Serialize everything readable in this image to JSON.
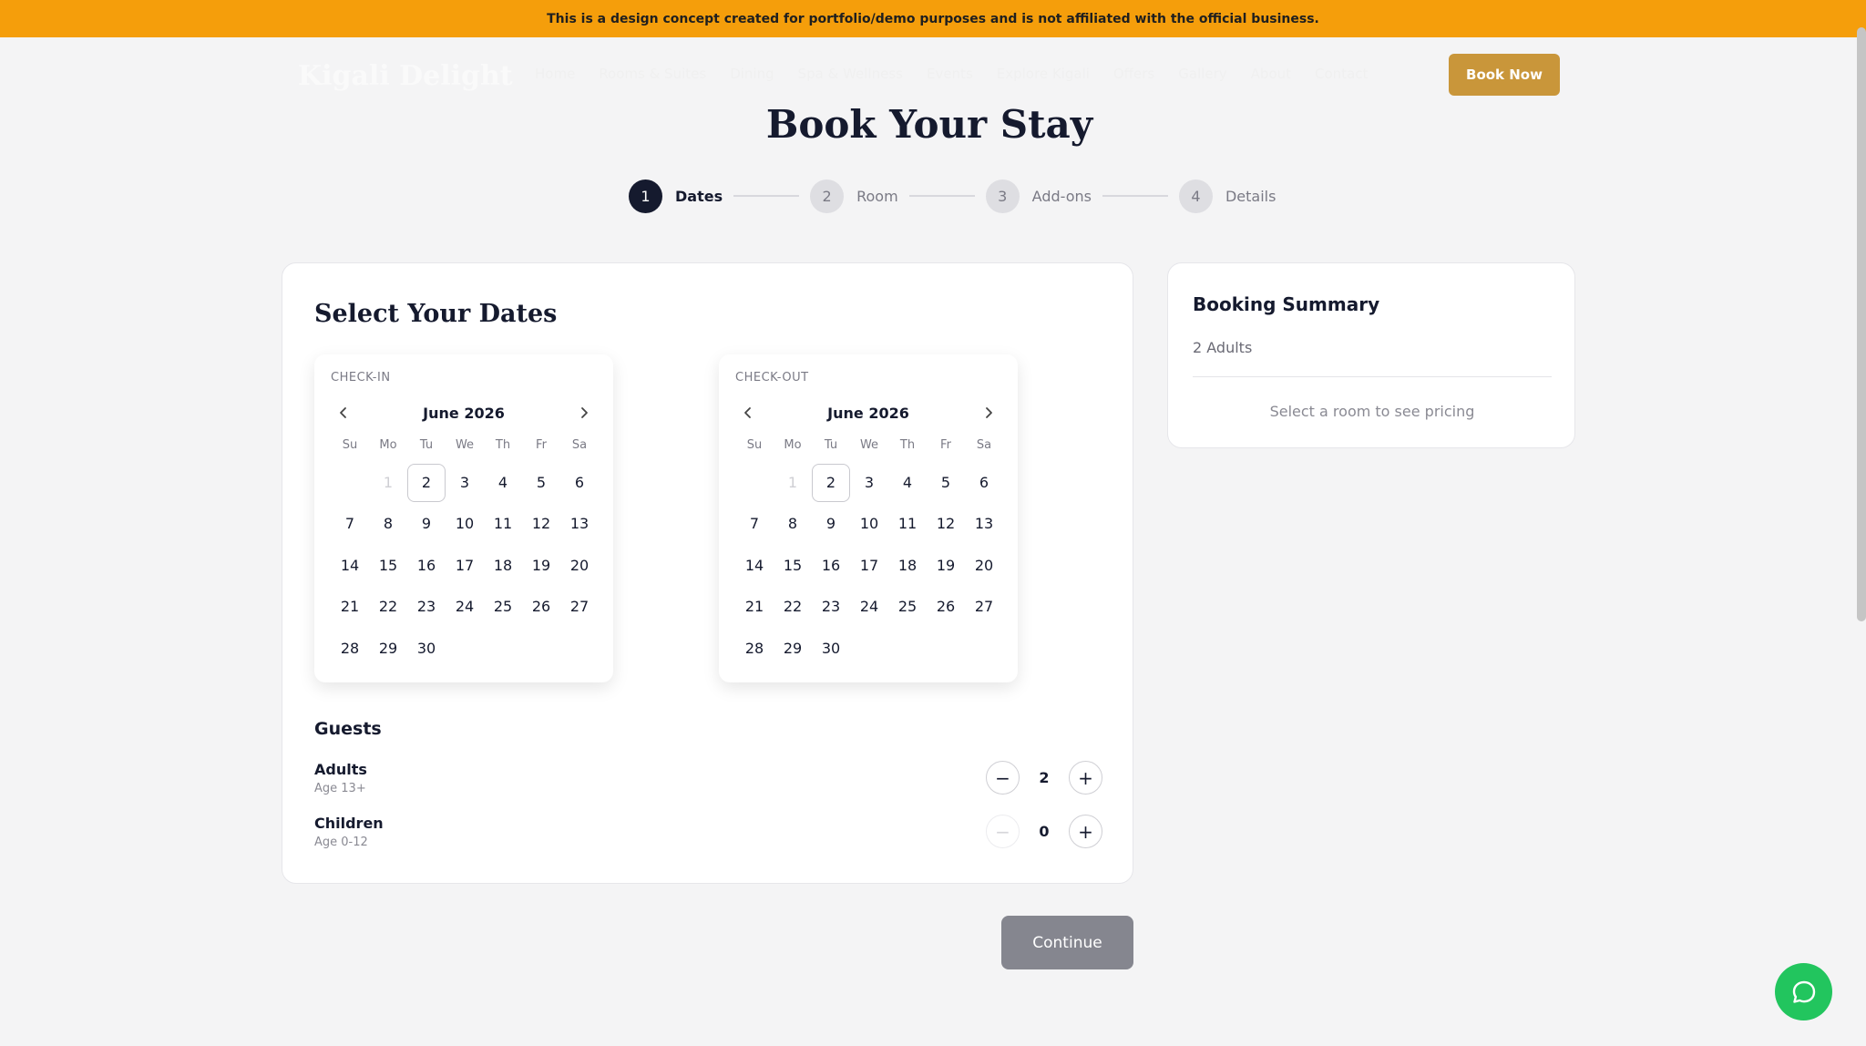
{
  "banner": {
    "text": "This is a design concept created for portfolio/demo purposes and is not affiliated with the official business."
  },
  "nav": {
    "logo": "Kigali Delight",
    "links": [
      "Home",
      "Rooms & Suites",
      "Dining",
      "Spa & Wellness",
      "Events",
      "Explore Kigali",
      "Offers",
      "Gallery",
      "About",
      "Contact"
    ],
    "book_now": "Book Now"
  },
  "page": {
    "title": "Book Your Stay"
  },
  "steps": [
    {
      "num": "1",
      "label": "Dates",
      "active": true
    },
    {
      "num": "2",
      "label": "Room",
      "active": false
    },
    {
      "num": "3",
      "label": "Add-ons",
      "active": false
    },
    {
      "num": "4",
      "label": "Details",
      "active": false
    }
  ],
  "dates": {
    "title": "Select Your Dates",
    "weekdays": [
      "Su",
      "Mo",
      "Tu",
      "We",
      "Th",
      "Fr",
      "Sa"
    ],
    "checkin": {
      "label": "CHECK-IN",
      "month": "June 2026"
    },
    "checkout": {
      "label": "CHECK-OUT",
      "month": "June 2026"
    },
    "first_weekday": 1,
    "days_in_month": 30,
    "disabled_days": [
      1
    ],
    "today": 2
  },
  "guests": {
    "title": "Guests",
    "adults": {
      "label": "Adults",
      "sub": "Age 13+",
      "value": "2"
    },
    "children": {
      "label": "Children",
      "sub": "Age 0-12",
      "value": "0"
    },
    "minus": "−",
    "plus": "+"
  },
  "actions": {
    "continue": "Continue"
  },
  "summary": {
    "title": "Booking Summary",
    "guests": "2 Adults",
    "note": "Select a room to see pricing"
  },
  "colors": {
    "banner": "#f59e0b",
    "accent": "#c9963a",
    "primary": "#151a2e",
    "chat": "#22c55e"
  },
  "icons": {
    "prev": "chevron-left-icon",
    "next": "chevron-right-icon",
    "chat": "chat-bubble-icon"
  }
}
